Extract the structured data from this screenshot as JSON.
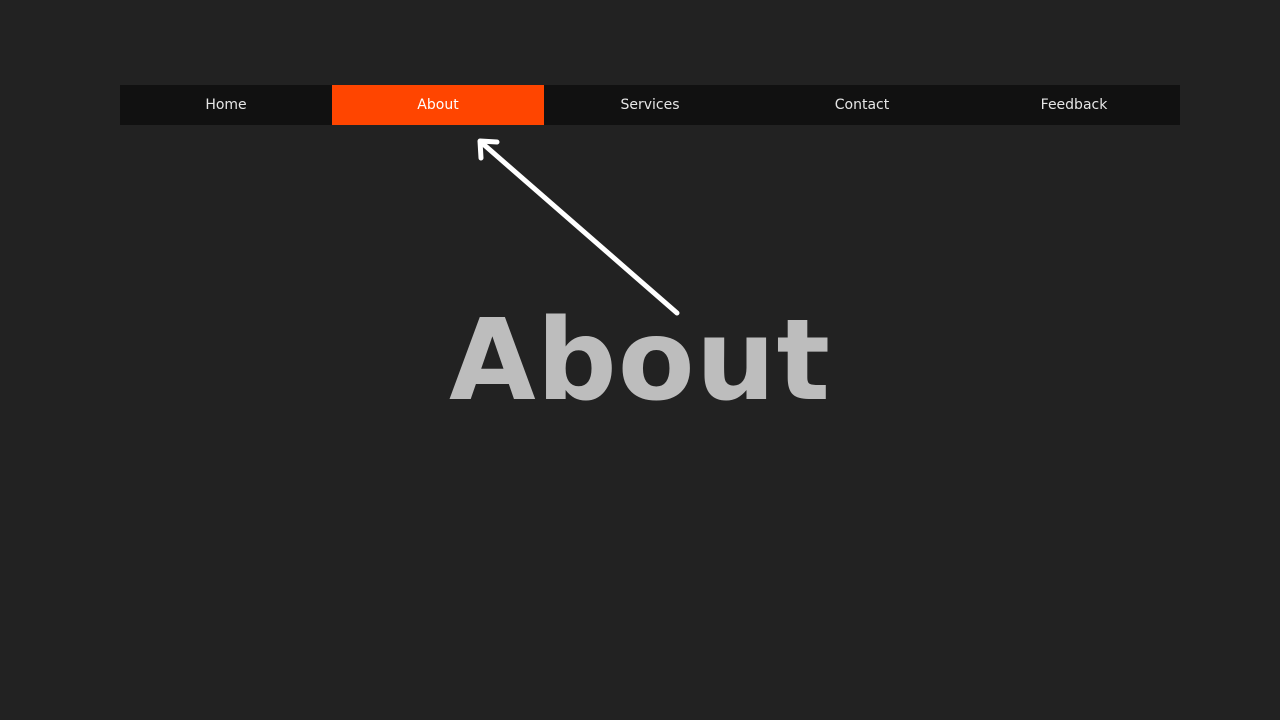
{
  "nav": {
    "items": [
      {
        "label": "Home"
      },
      {
        "label": "About"
      },
      {
        "label": "Services"
      },
      {
        "label": "Contact"
      },
      {
        "label": "Feedback"
      }
    ],
    "active": "About"
  },
  "main": {
    "heading": "About"
  },
  "colors": {
    "background": "#222222",
    "nav_background": "#111111",
    "accent": "#ff4500",
    "heading": "#bdbdbd",
    "annotation_arrow": "#ffffff"
  },
  "icons": {
    "annotation": "arrow-icon"
  }
}
